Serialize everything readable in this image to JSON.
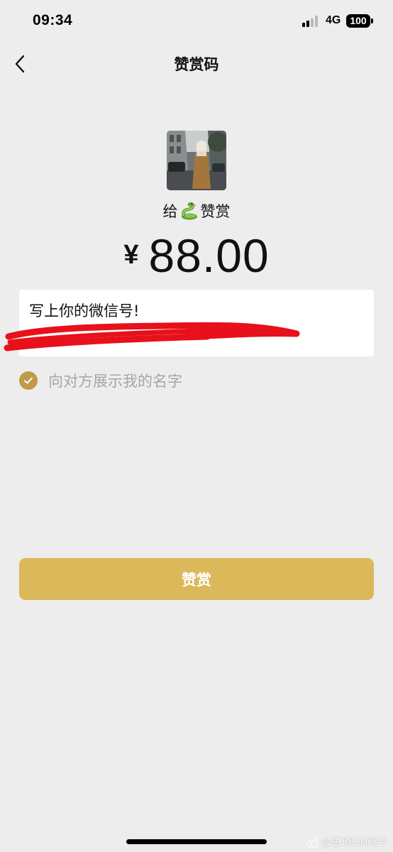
{
  "status_bar": {
    "time": "09:34",
    "network": "4G",
    "battery": "100"
  },
  "nav": {
    "title": "赞赏码"
  },
  "recipient": {
    "give_prefix": "给",
    "give_suffix": "赞赏",
    "emoji": "snake-emoji"
  },
  "amount": {
    "currency": "¥",
    "value": "88.00"
  },
  "message": {
    "text": "写上你的微信号!"
  },
  "options": {
    "show_name_label": "向对方展示我的名字",
    "show_name_checked": true
  },
  "actions": {
    "reward_label": "赞赏"
  },
  "watermark": {
    "text": "@思琦S的碎片"
  },
  "colors": {
    "background": "#ededed",
    "accent_gold": "#dbb85a",
    "check_gold": "#c09a4a",
    "redaction_red": "#e8101a"
  }
}
